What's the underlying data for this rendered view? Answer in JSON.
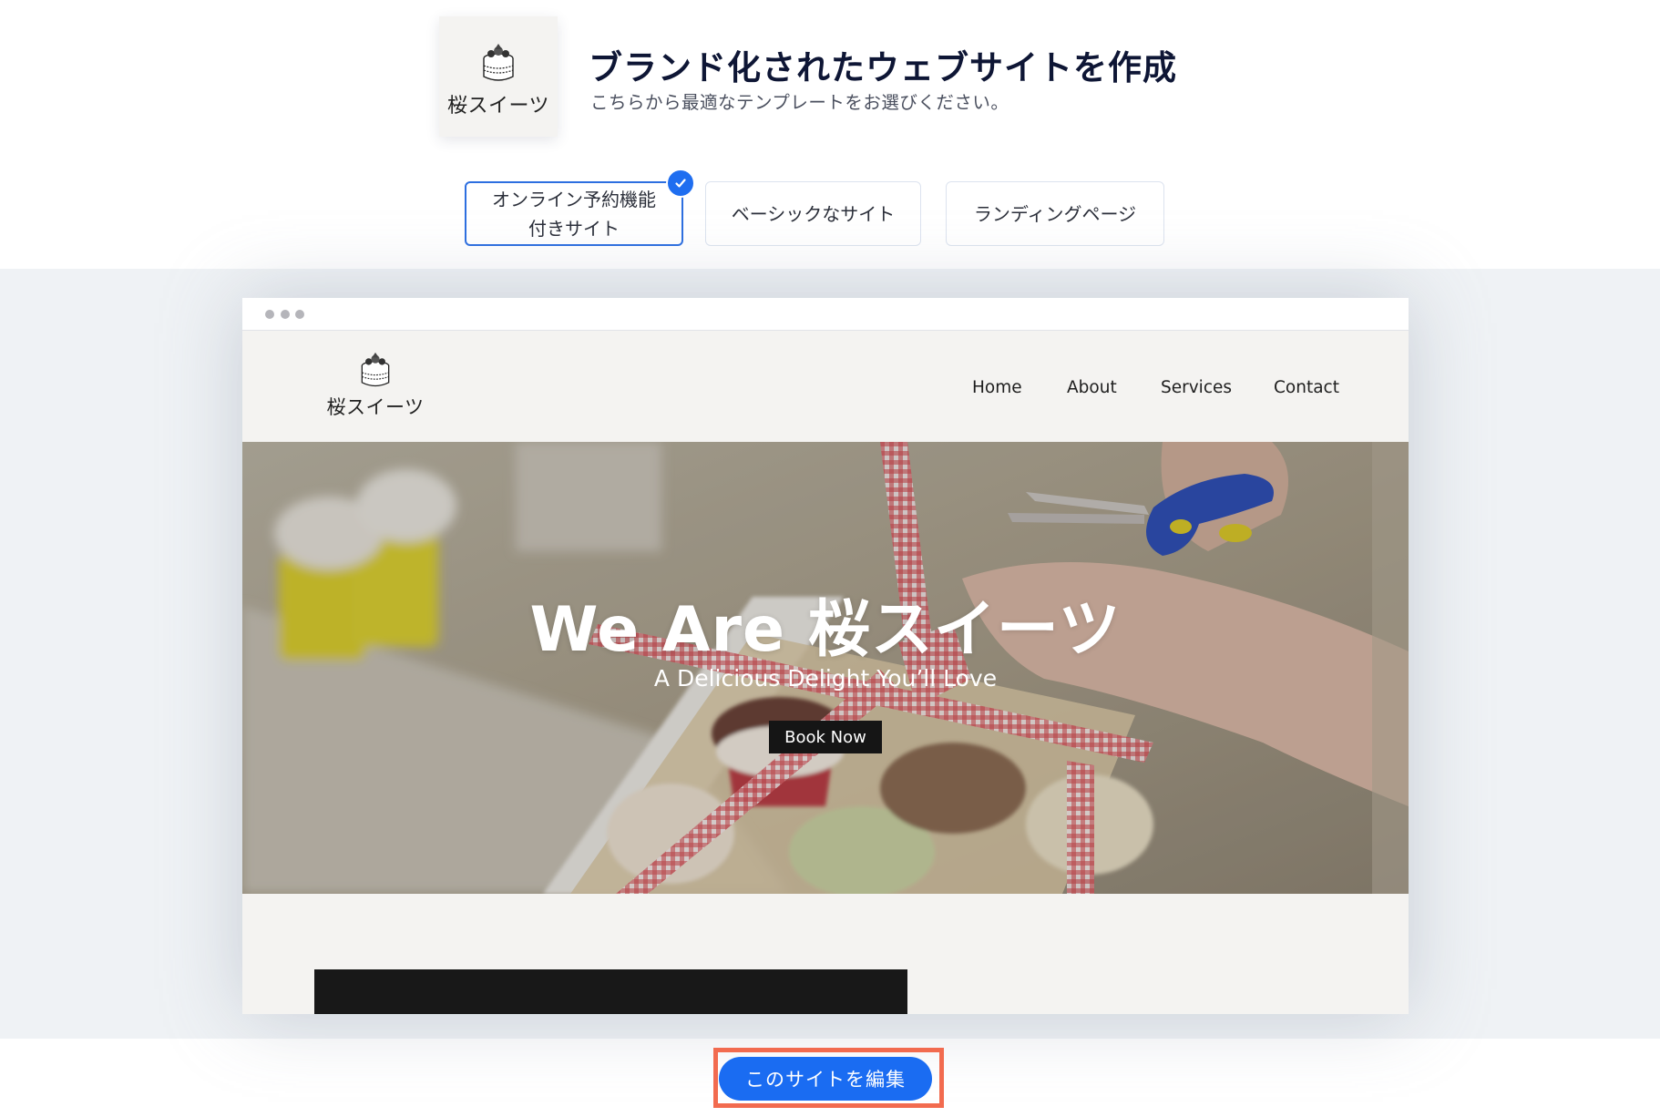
{
  "brand": {
    "name": "桜スイーツ",
    "logo_icon": "cake-icon"
  },
  "header": {
    "title": "ブランド化されたウェブサイトを作成",
    "subtitle": "こちらから最適なテンプレートをお選びください。"
  },
  "tabs": [
    {
      "label": "オンライン予約機能\n付きサイト",
      "line1": "オンライン予約機能",
      "line2": "付きサイト",
      "selected": true
    },
    {
      "label": "ベーシックなサイト",
      "selected": false
    },
    {
      "label": "ランディングページ",
      "selected": false
    }
  ],
  "preview": {
    "titlebar_dots": 3,
    "nav": [
      "Home",
      "About",
      "Services",
      "Contact"
    ],
    "hero": {
      "title": "We Are 桜スイーツ",
      "subtitle": "A Delicious Delight You’ll Love",
      "cta": "Book Now"
    }
  },
  "actions": {
    "edit_site": "このサイトを編集"
  },
  "colors": {
    "accent_blue": "#1a6cf2",
    "selected_border": "#2d6fe0",
    "highlight": "#f26b4f",
    "title_text": "#0e1635",
    "band_bg": "#eff2f5",
    "site_bg": "#f4f3f1"
  }
}
